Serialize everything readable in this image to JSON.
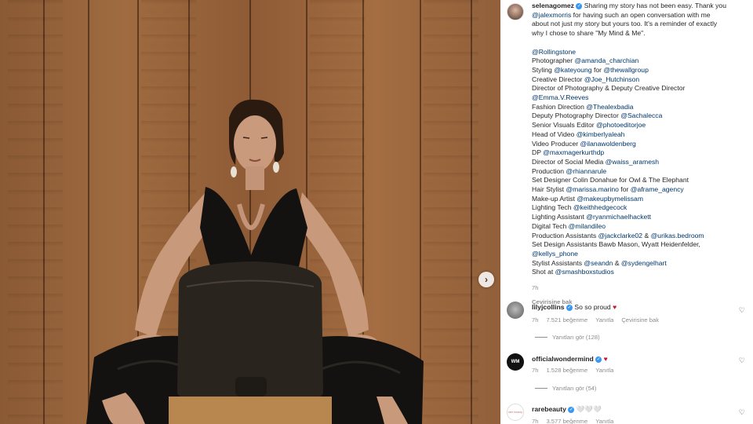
{
  "post": {
    "author": "selenagomez",
    "caption_lines": [
      "Sharing my story has not been easy. Thank you",
      "@jalexmorris for having such an open conversation with me",
      "about not just my story but yours too. It's a reminder of exactly",
      "why I chose to share \"My Mind & Me\".",
      "",
      "@Rollingstone",
      "Photographer @amanda_charchian",
      "Styling @kateyoung for @thewallgroup",
      "Creative Director @Joe_Hutchinson",
      "Director of Photography & Deputy Creative Director",
      "@Emma.V.Reeves",
      "Fashion Direction @Thealexbadia",
      "Deputy Photography Director @Sachalecca",
      "Senior Visuals Editor @photoeditorjoe",
      "Head of Video @kimberlyaleah",
      "Video Producer @ilanawoldenberg",
      "DP @maxmagerkurthdp",
      "Director of Social Media @waiss_aramesh",
      "Production @rhiannarule",
      "Set Designer Colin Donahue for Owl & The Elephant",
      "Hair Stylist @marissa.marino for @aframe_agency",
      "Make-up Artist @makeupbymelissam",
      "Lighting Tech @keithhedgecock",
      "Lighting Assistant @ryanmichaelhackett",
      "Digital Tech @milandileo",
      "Production Assistants @jackclarke02 & @urikas.bedroom",
      "Set Design Assistants Bawb Mason, Wyatt Heidenfelder,",
      "@kellys_phone",
      "Stylist Assistants @seandn & @sydengelhart",
      "Shot at @smashboxstudios"
    ],
    "time": "7h",
    "translate": "Çevirisine bak"
  },
  "comments": [
    {
      "user": "lilyjcollins",
      "text": "So so proud",
      "time": "7h",
      "likes": "7.521 beğenme",
      "reply": "Yanıtla",
      "translate": "Çevirisine bak",
      "view_replies": "Yanıtları gör (128)"
    },
    {
      "user": "officialwondermind",
      "text": "",
      "time": "7h",
      "likes": "1.528 beğenme",
      "reply": "Yanıtla",
      "view_replies": "Yanıtları gör (54)"
    },
    {
      "user": "rarebeauty",
      "text": "🤍🤍🤍",
      "time": "7h",
      "likes": "3.577 beğenme",
      "reply": "Yanıtla"
    }
  ],
  "avatars": {
    "officialwondermind": "WM",
    "rarebeauty": "rare beauty"
  },
  "icons": {
    "heart": "♡",
    "red_heart": "♥",
    "next": "›",
    "check": "✓"
  },
  "colors": {
    "link": "#00376b",
    "meta": "#8e8e8e",
    "verified": "#3897f0",
    "heart_red": "#c4192c"
  }
}
